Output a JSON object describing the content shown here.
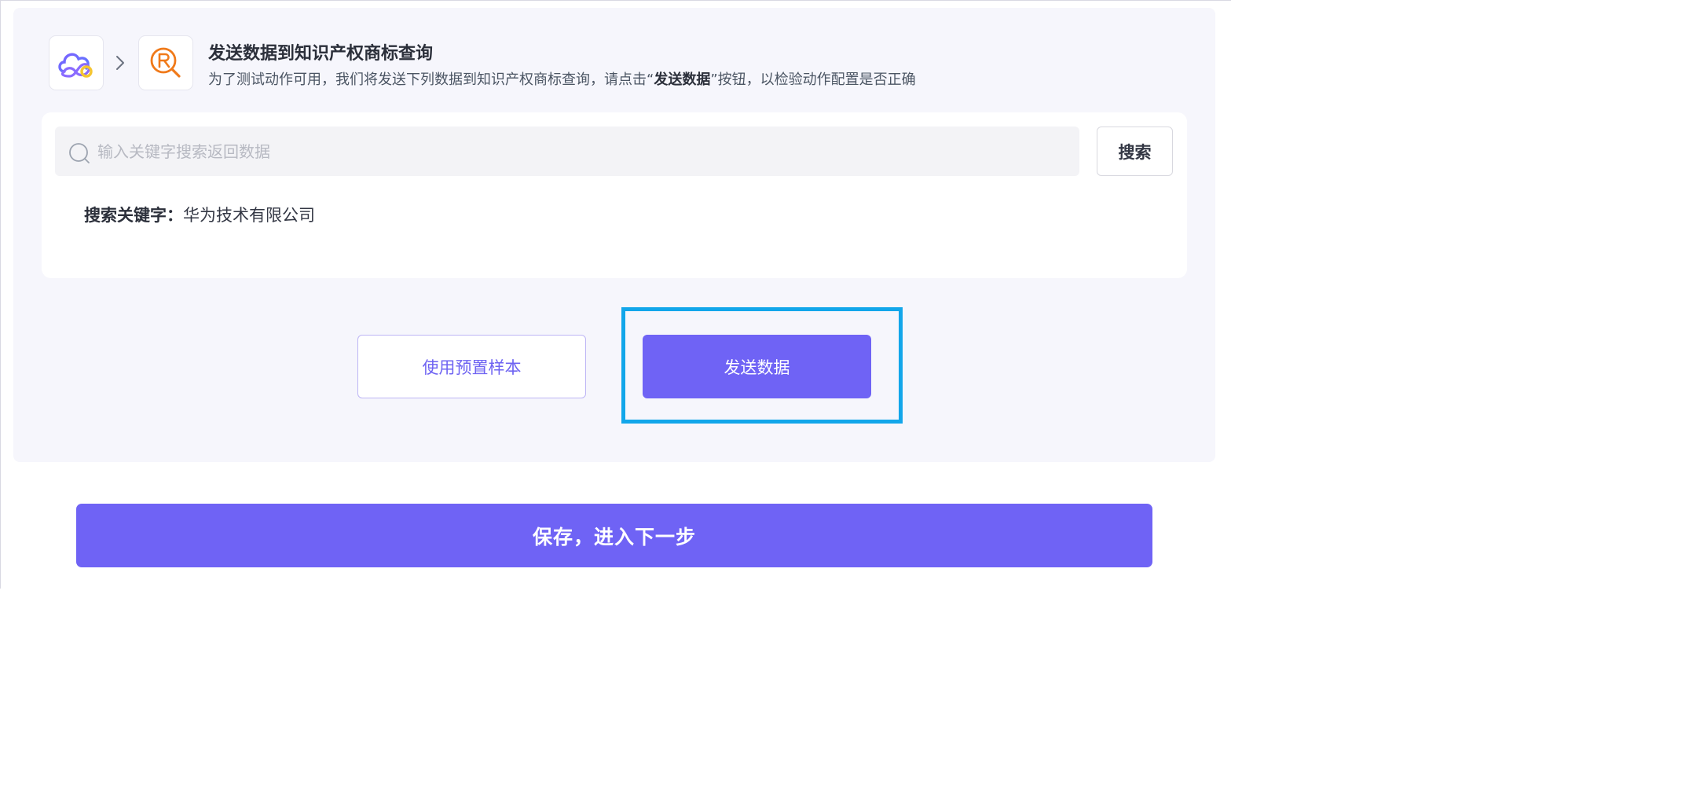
{
  "header": {
    "source_app_icon": "cloud-connector-icon",
    "target_app_icon": "registered-trademark-search-icon",
    "arrow_icon": "chevron-right-icon",
    "title": "发送数据到知识产权商标查询",
    "subtitle_before": "为了测试动作可用，我们将发送下列数据到知识产权商标查询，请点击“",
    "subtitle_bold": "发送数据",
    "subtitle_after": "”按钮，以检验动作配置是否正确"
  },
  "search": {
    "icon": "search-icon",
    "placeholder": "输入关键字搜索返回数据",
    "value": "",
    "button_label": "搜索"
  },
  "data_fields": {
    "keyword_label": "搜索关键字：",
    "keyword_value": "华为技术有限公司"
  },
  "actions": {
    "use_sample_label": "使用预置样本",
    "send_data_label": "发送数据"
  },
  "footer": {
    "save_next_label": "保存，进入下一步"
  },
  "colors": {
    "accent": "#6f63f5",
    "highlight": "#12a6ea",
    "panel_bg": "#f6f6fc",
    "trademark_orange": "#f07a1a"
  }
}
